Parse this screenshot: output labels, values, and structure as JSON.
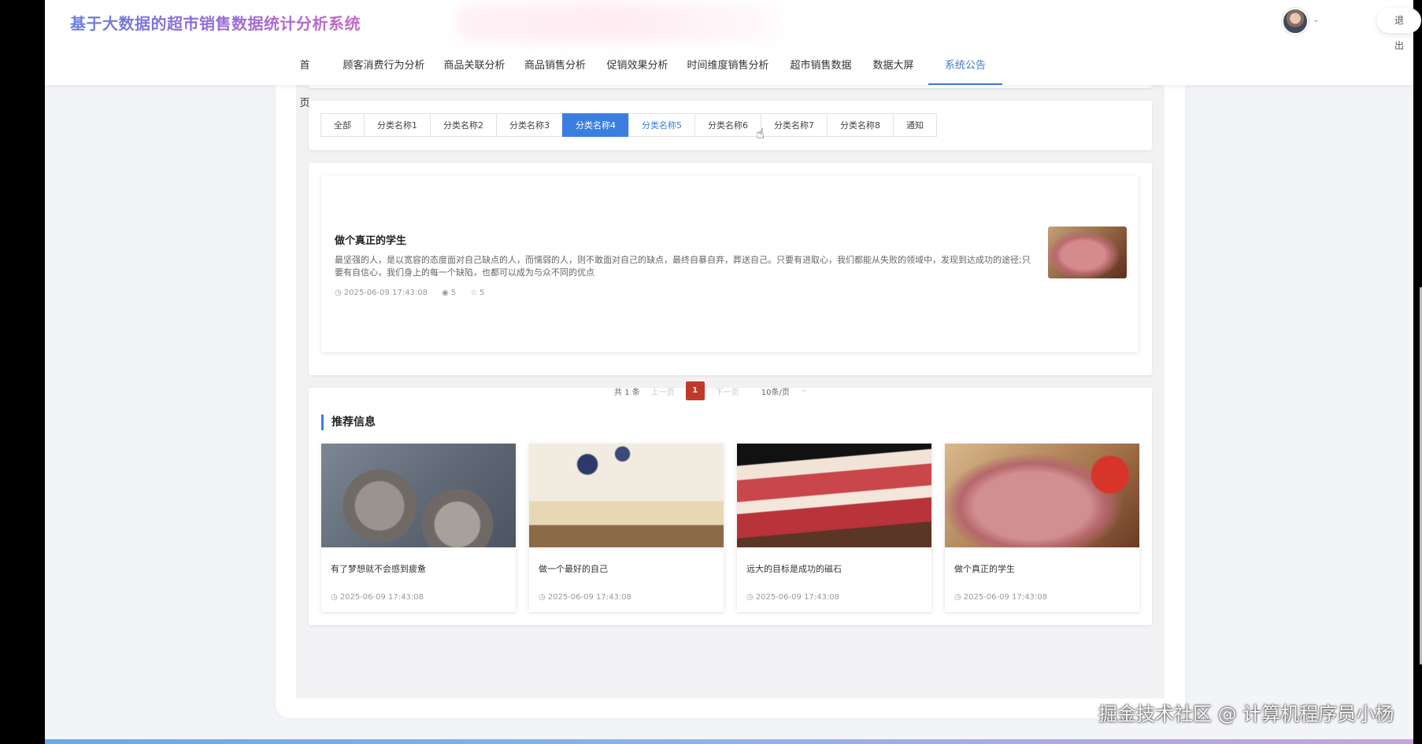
{
  "header": {
    "app_title": "基于大数据的超市销售数据统计分析系统",
    "logout_label": "退出"
  },
  "nav": {
    "items": [
      {
        "label": "首页"
      },
      {
        "label": "顾客消费行为分析"
      },
      {
        "label": "商品关联分析"
      },
      {
        "label": "商品销售分析"
      },
      {
        "label": "促销效果分析"
      },
      {
        "label": "时间维度销售分析"
      },
      {
        "label": "超市销售数据"
      },
      {
        "label": "数据大屏"
      },
      {
        "label": "系统公告"
      }
    ],
    "active": "系统公告"
  },
  "tabs": {
    "items": [
      "全部",
      "分类名称1",
      "分类名称2",
      "分类名称3",
      "分类名称4",
      "分类名称5",
      "分类名称6",
      "分类名称7",
      "分类名称8",
      "通知"
    ],
    "active": "分类名称4",
    "hover": "分类名称5"
  },
  "article": {
    "title": "做个真正的学生",
    "desc": "最坚强的人，是以宽容的态度面对自己缺点的人，而懦弱的人，则不敢面对自己的缺点，最终自暴自弃，葬送自己。只要有进取心，我们都能从失败的领域中，发现到达成功的途径;只要有自信心，我们身上的每一个缺陷，也都可以成为与众不同的优点",
    "date": "2025-06-09 17:43:08",
    "views": "5",
    "favorites": "5"
  },
  "pagination": {
    "total": "共 1 条",
    "prev": "上一页",
    "page": "1",
    "next": "下一页",
    "page_size": "10条/页"
  },
  "recommend": {
    "heading": "推荐信息",
    "cards": [
      {
        "title": "有了梦想就不会感到疲惫",
        "date": "2025-06-09 17:43:08"
      },
      {
        "title": "做一个最好的自己",
        "date": "2025-06-09 17:43:08"
      },
      {
        "title": "远大的目标是成功的磁石",
        "date": "2025-06-09 17:43:08"
      },
      {
        "title": "做个真正的学生",
        "date": "2025-06-09 17:43:08"
      }
    ]
  },
  "watermark": "掘金技术社区 @ 计算机程序员小杨",
  "colors": {
    "accent": "#3a7fe0",
    "page_active": "#c0392b"
  }
}
